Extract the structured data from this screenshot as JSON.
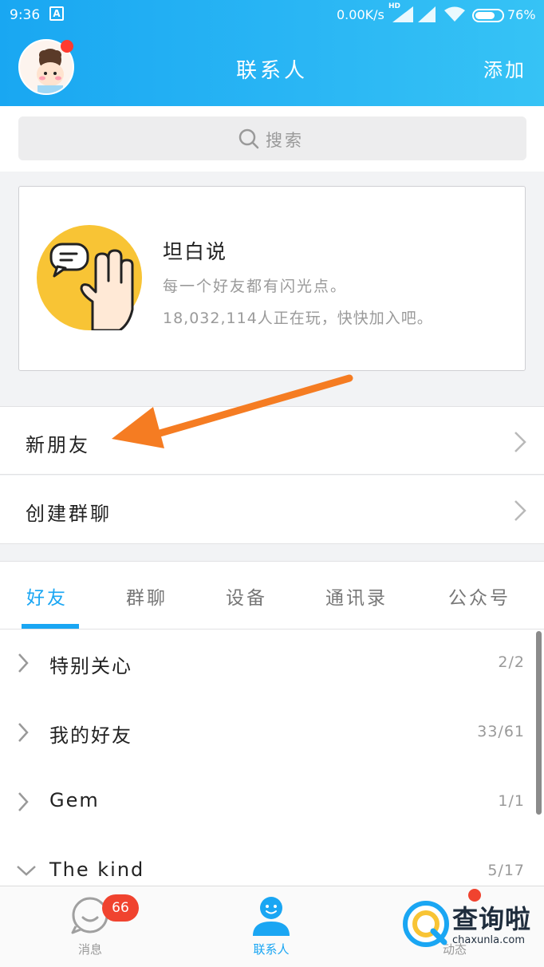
{
  "status_bar": {
    "time": "9:36",
    "app_icon_letter": "A",
    "speed": "0.00K/s",
    "hd": "HD",
    "battery_percent": "76%",
    "battery_level": 0.76
  },
  "header": {
    "title": "联系人",
    "add_label": "添加"
  },
  "search": {
    "placeholder": "搜索"
  },
  "promo_card": {
    "title": "坦白说",
    "subtitle": "每一个好友都有闪光点。",
    "players": "18,032,114人正在玩，快快加入吧。"
  },
  "menu": {
    "new_friends": "新朋友",
    "create_group_chat": "创建群聊"
  },
  "tabs": [
    {
      "label": "好友",
      "active": true
    },
    {
      "label": "群聊",
      "active": false
    },
    {
      "label": "设备",
      "active": false
    },
    {
      "label": "通讯录",
      "active": false
    },
    {
      "label": "公众号",
      "active": false
    }
  ],
  "groups": [
    {
      "name": "特别关心",
      "count": "2/2",
      "expanded": false
    },
    {
      "name": "我的好友",
      "count": "33/61",
      "expanded": false
    },
    {
      "name": "Gem",
      "count": "1/1",
      "expanded": false
    },
    {
      "name": "The kind",
      "count": "5/17",
      "expanded": true
    }
  ],
  "bottom_nav": {
    "messages_label": "消息",
    "messages_badge": "66",
    "contacts_label": "联系人",
    "third_label_partial": "动态"
  },
  "watermark": {
    "brand": "查询啦",
    "url": "chaxunla.com"
  },
  "colors": {
    "accent": "#1aa6f3",
    "badge": "#f0432f",
    "annotation_arrow": "#f57c22"
  }
}
